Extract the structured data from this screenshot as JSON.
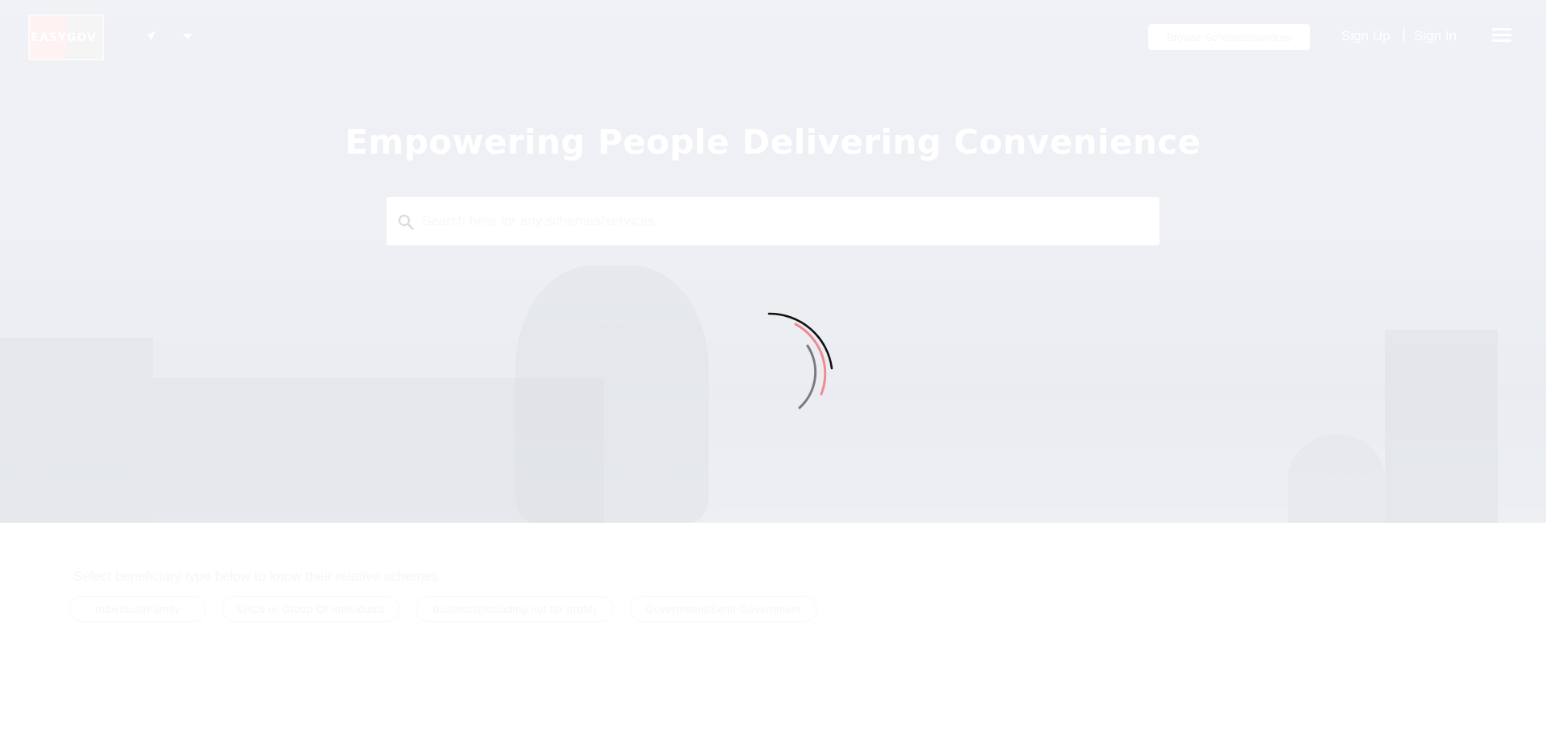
{
  "header": {
    "logo_text_left": "EASY",
    "logo_text_right": "GOV",
    "logo_reg_mark": "®",
    "browse_label": "Browse Schemes/Services",
    "sign_up": "Sign Up",
    "separator": "|",
    "sign_in": "Sign In",
    "icons": [
      "location-arrow-icon",
      "chevron-down-icon",
      "hamburger-menu-icon"
    ]
  },
  "hero": {
    "title": "Empowering People Delivering Convenience",
    "search_placeholder": "Search here for any schemes/services",
    "search_icon": "search-icon"
  },
  "beneficiary": {
    "title": "Select beneficiary type below to know their relative schemes",
    "options": [
      "Individual/Family",
      "SHCs or Group Of Individuals",
      "Business(Including not for profit)",
      "Government/Semi-Government"
    ]
  },
  "colors": {
    "spinner_dark": "#111111",
    "spinner_accent": "#f08a8f",
    "spinner_grey": "#7a7a7a",
    "logo_pink": "#f6b8bd"
  }
}
